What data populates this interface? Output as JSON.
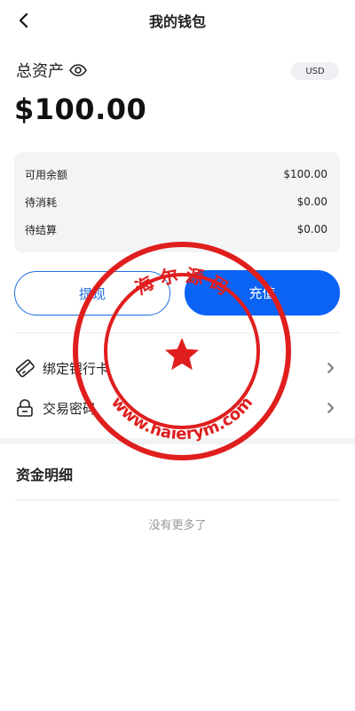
{
  "header": {
    "title": "我的钱包",
    "back_icon": "back-arrow-icon"
  },
  "assets": {
    "label": "总资产",
    "eye_icon": "eye-icon",
    "currency": "USD",
    "amount": "$100.00"
  },
  "balance_card": {
    "rows": [
      {
        "label": "可用余额",
        "value": "$100.00"
      },
      {
        "label": "待消耗",
        "value": "$0.00"
      },
      {
        "label": "待结算",
        "value": "$0.00"
      }
    ]
  },
  "actions": {
    "withdraw": "提现",
    "recharge": "充值"
  },
  "menu": [
    {
      "label": "绑定银行卡",
      "icon": "bank-card-icon"
    },
    {
      "label": "交易密码",
      "icon": "lock-icon"
    }
  ],
  "details": {
    "title": "资金明细",
    "empty_text": "没有更多了"
  },
  "watermark": {
    "top_text": "海 尔 源 码",
    "bottom_text": "www.haierym.com",
    "color": "#e01e1e"
  },
  "colors": {
    "primary": "#0b63f6",
    "outline": "#1f6fe0",
    "card_bg": "#f3f4f6"
  }
}
